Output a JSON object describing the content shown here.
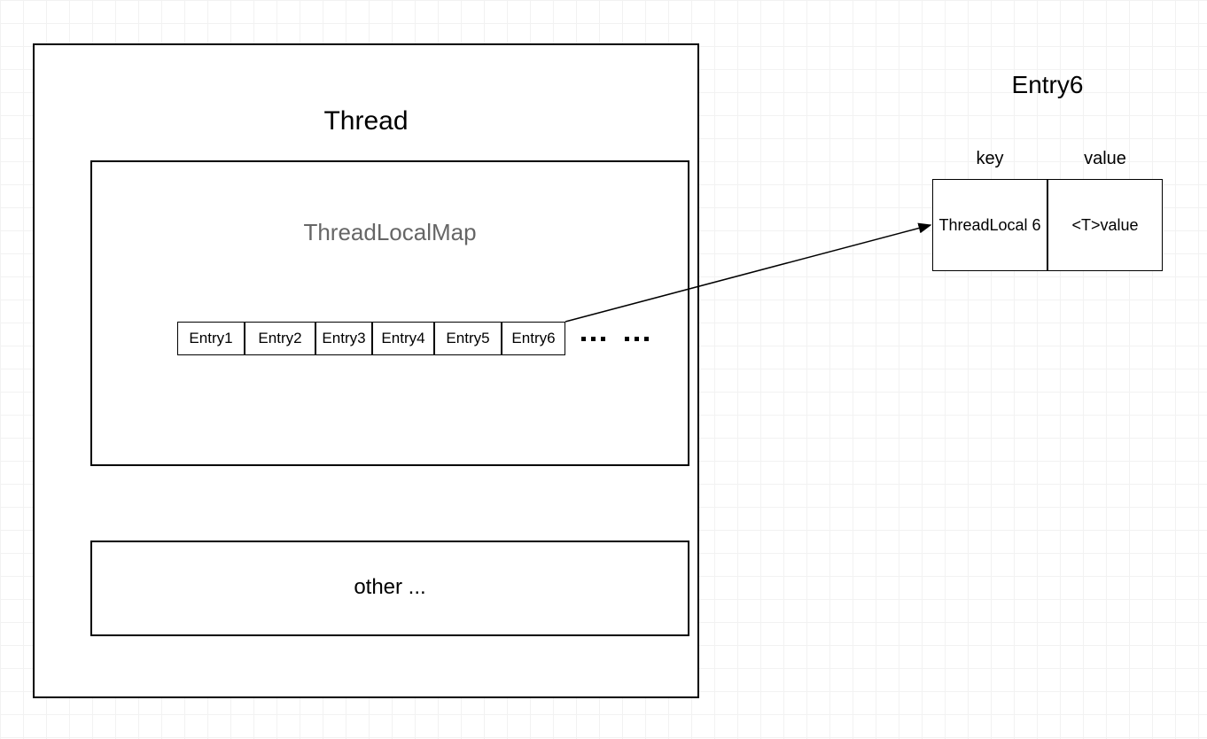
{
  "thread": {
    "title": "Thread",
    "map": {
      "title": "ThreadLocalMap",
      "entries": [
        "Entry1",
        "Entry2",
        "Entry3",
        "Entry4",
        "Entry5",
        "Entry6"
      ],
      "ellipsis1": "…",
      "ellipsis2": "…"
    },
    "other": "other ..."
  },
  "detail": {
    "title": "Entry6",
    "keyHeader": "key",
    "valueHeader": "value",
    "keyCell": "ThreadLocal 6",
    "valueCell": "<T>value"
  }
}
